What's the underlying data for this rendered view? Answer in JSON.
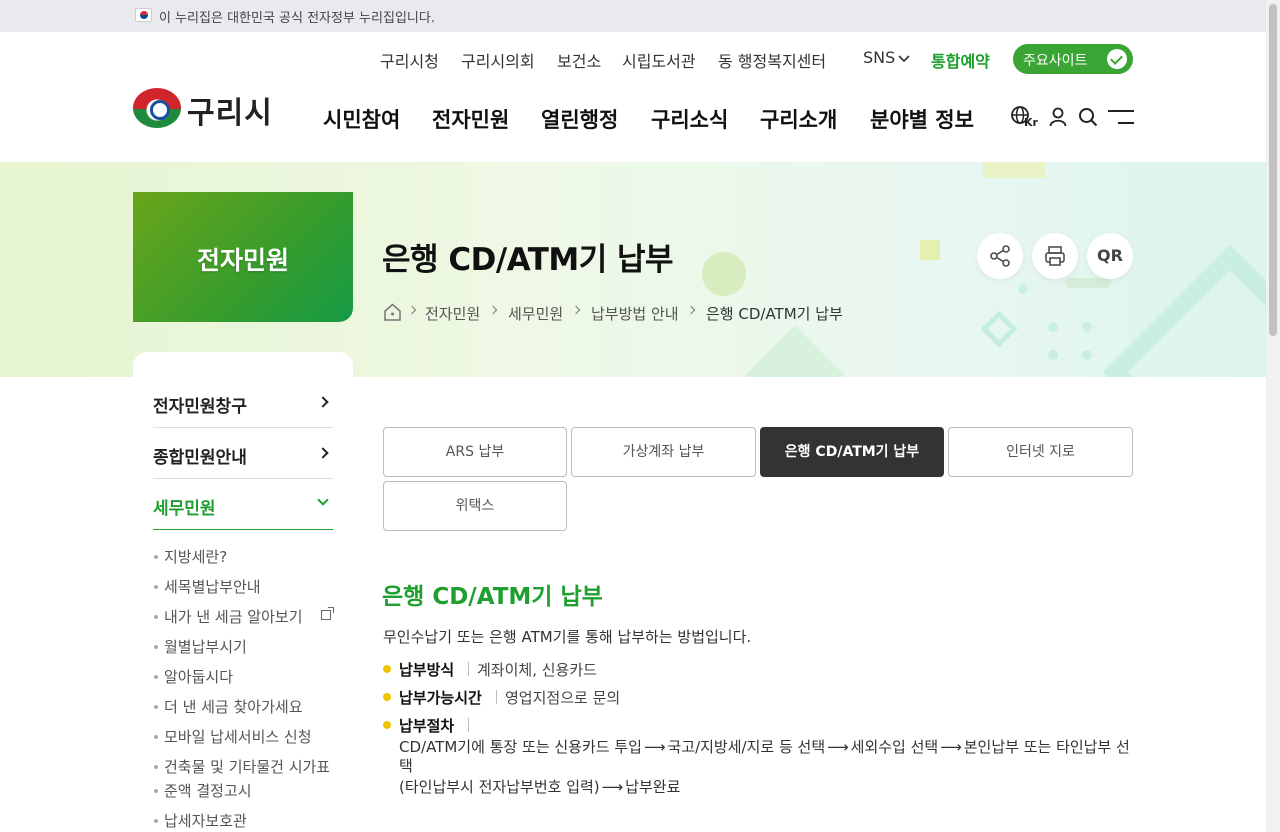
{
  "notice": {
    "text": "이 누리집은 대한민국 공식 전자정부 누리집입니다."
  },
  "util_nav": {
    "items": [
      "구리시청",
      "구리시의회",
      "보건소",
      "시립도서관",
      "동 행정복지센터"
    ],
    "sns": "SNS",
    "reserve": "통합예약",
    "main_sites": "주요사이트"
  },
  "logo": {
    "name": "구리시"
  },
  "gnb": [
    "시민참여",
    "전자민원",
    "열린행정",
    "구리소식",
    "구리소개",
    "분야별 정보"
  ],
  "lang": "Kr",
  "section": {
    "title": "전자민원"
  },
  "page": {
    "title": "은행 CD/ATM기 납부",
    "qr": "QR"
  },
  "breadcrumb": [
    "전자민원",
    "세무민원",
    "납부방법 안내",
    "은행 CD/ATM기 납부"
  ],
  "side_menu": {
    "items": [
      "전자민원창구",
      "종합민원안내",
      "세무민원"
    ],
    "sub_items": [
      "지방세란?",
      "세목별납부안내",
      "내가 낸 세금 알아보기",
      "월별납부시기",
      "알아둡시다",
      "더 낸 세금 찾아가세요",
      "모바일 납세서비스 신청",
      "건축물 및 기타물건 시가표",
      "준액 결정고시",
      "납세자보호관"
    ]
  },
  "tabs": [
    "ARS 납부",
    "가상계좌 납부",
    "은행 CD/ATM기 납부",
    "인터넷 지로",
    "위택스"
  ],
  "content": {
    "title": "은행 CD/ATM기 납부",
    "description": "무인수납기 또는 은행 ATM기를 통해 납부하는 방법입니다.",
    "method_term": "납부방식",
    "method_value": "계좌이체, 신용카드",
    "time_term": "납부가능시간",
    "time_value": "영업지점으로 문의",
    "process_term": "납부절차",
    "process_line1": [
      "CD/ATM기에 통장 또는 신용카드 투입",
      "국고/지방세/지로 등 선택",
      "세외수입 선택",
      "본인납부 또는 타인납부 선"
    ],
    "process_line2": "택",
    "process_line3": [
      "(타인납부시 전자납부번호 입력)",
      "납부완료"
    ]
  },
  "colors": {
    "accent": "#1e9f2f",
    "bullet": "#f0c400",
    "active_tab": "#333333"
  }
}
